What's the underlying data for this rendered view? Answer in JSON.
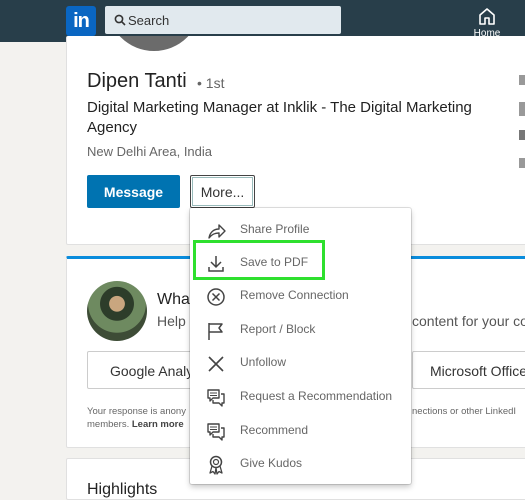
{
  "nav": {
    "logo_text": "in",
    "search_placeholder": "Search",
    "home_label": "Home"
  },
  "profile": {
    "name": "Dipen Tanti",
    "degree": "• 1st",
    "headline": "Digital Marketing Manager at Inklik - The Digital Marketing Agency",
    "location": "New Delhi Area, India",
    "message_label": "Message",
    "more_label": "More..."
  },
  "prompt": {
    "title": "What",
    "help": "Help c",
    "content_for": "content for your co",
    "option_left": "Google Analy",
    "option_right": "Microsoft Office",
    "note_line1": "Your response is anony",
    "note_line2_prefix": "members.",
    "learn_more": "Learn more",
    "note_right": "nections or other LinkedI"
  },
  "highlights_title": "Highlights",
  "more_menu": {
    "items": [
      {
        "label": "Share Profile",
        "icon": "share-icon"
      },
      {
        "label": "Save to PDF",
        "icon": "download-icon"
      },
      {
        "label": "Remove Connection",
        "icon": "remove-circle-icon"
      },
      {
        "label": "Report / Block",
        "icon": "flag-icon"
      },
      {
        "label": "Unfollow",
        "icon": "x-icon"
      },
      {
        "label": "Request a Recommendation",
        "icon": "speech-bubbles-icon"
      },
      {
        "label": "Recommend",
        "icon": "speech-bubbles-icon"
      },
      {
        "label": "Give Kudos",
        "icon": "award-ribbon-icon"
      }
    ]
  },
  "colors": {
    "nav_bg": "#283e4a",
    "accent": "#0073b1",
    "highlight_box": "#2ee02e"
  }
}
